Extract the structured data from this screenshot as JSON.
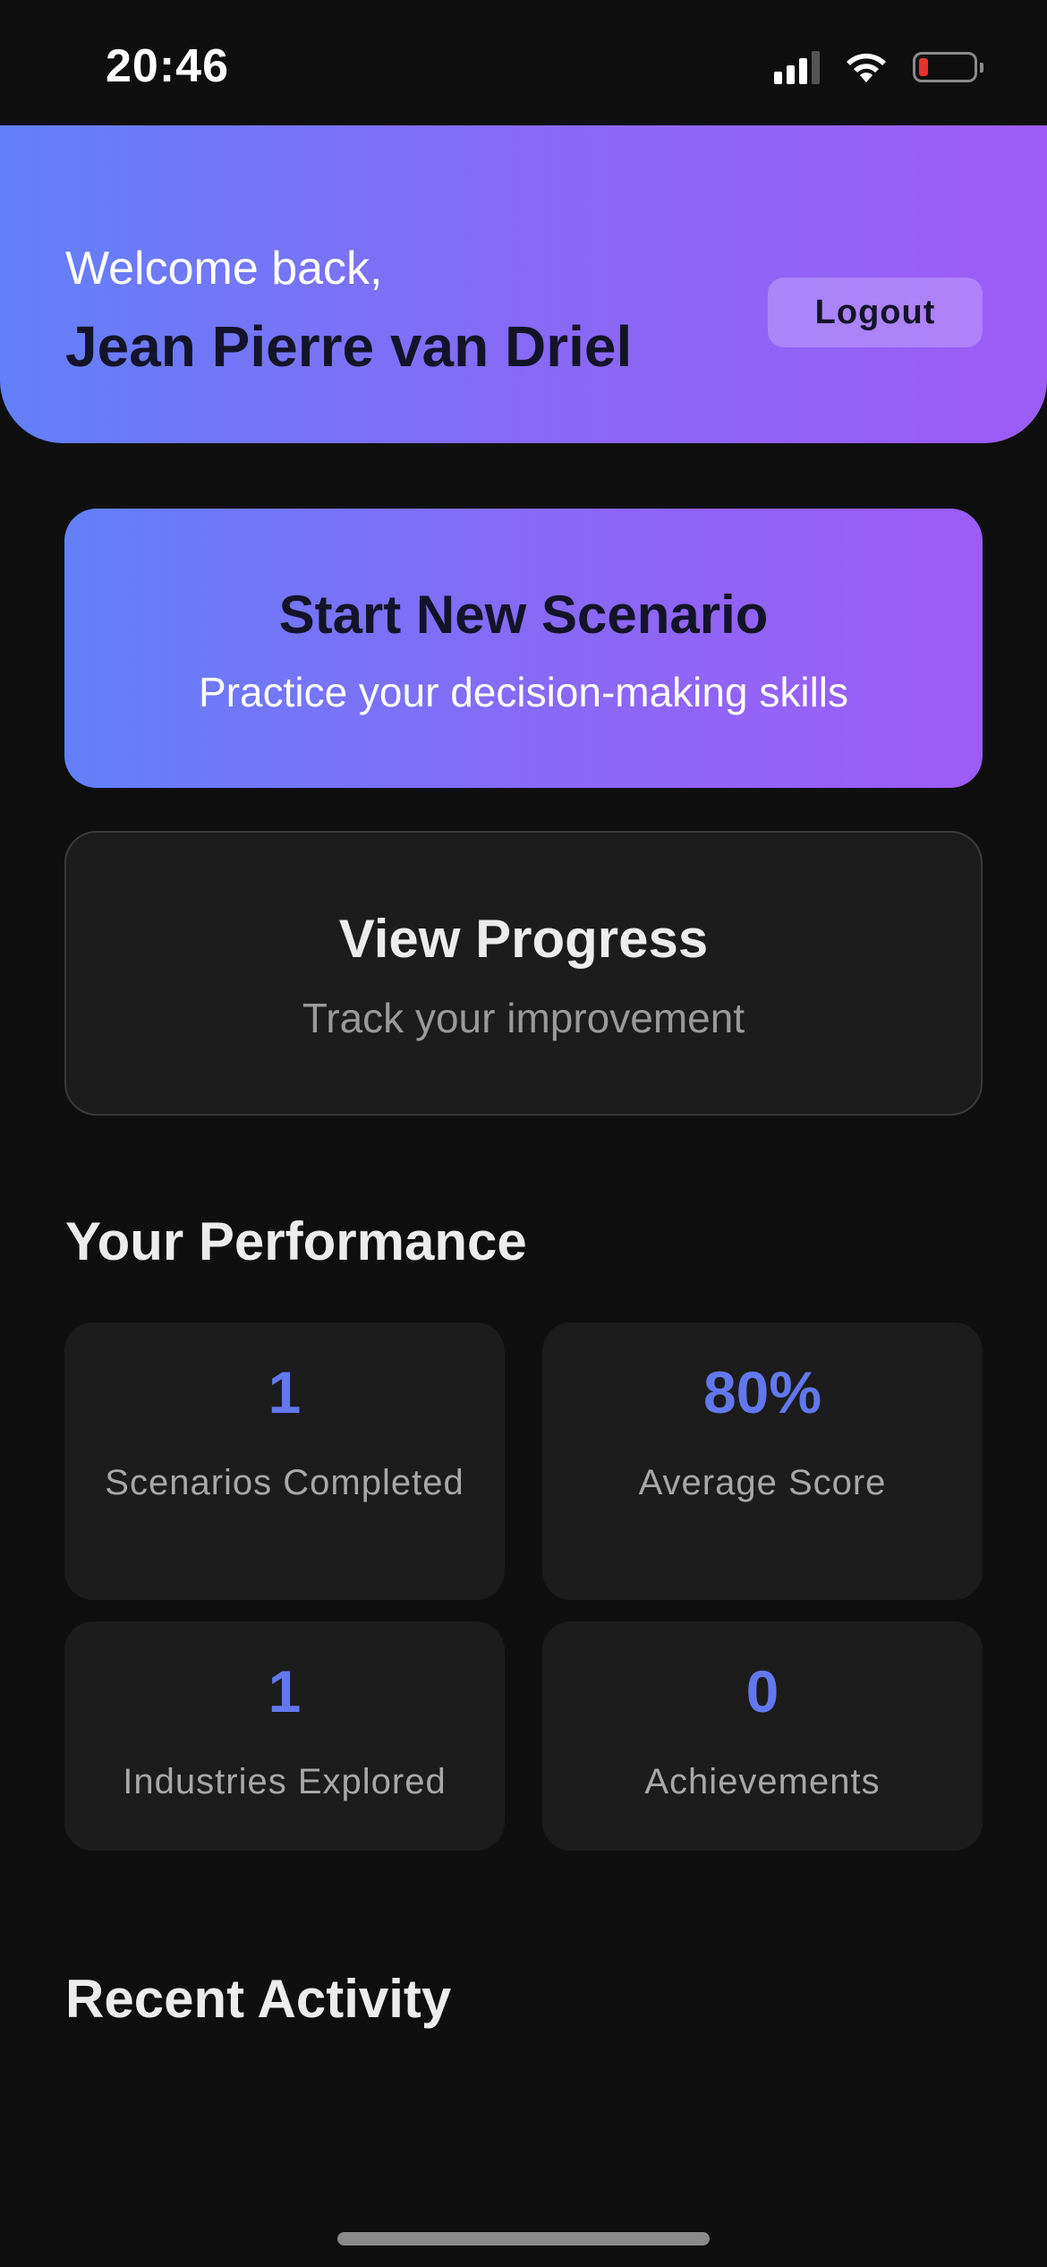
{
  "status_bar": {
    "time": "20:46",
    "icons": [
      "signal-icon",
      "wifi-icon",
      "battery-icon"
    ],
    "battery_color": "#e5322d"
  },
  "header": {
    "welcome": "Welcome back,",
    "user_name": "Jean Pierre van Driel",
    "logout_label": "Logout",
    "gradient_colors": [
      "#6380f8",
      "#9d5cf6"
    ]
  },
  "actions": {
    "start": {
      "title": "Start New Scenario",
      "subtitle": "Practice your decision-making skills"
    },
    "progress": {
      "title": "View Progress",
      "subtitle": "Track your improvement"
    }
  },
  "performance": {
    "title": "Your Performance",
    "stats": [
      {
        "value": "1",
        "label": "Scenarios Completed"
      },
      {
        "value": "80%",
        "label": "Average Score"
      },
      {
        "value": "1",
        "label": "Industries Explored"
      },
      {
        "value": "0",
        "label": "Achievements"
      }
    ],
    "value_color": "#6378ee"
  },
  "recent_activity": {
    "title": "Recent Activity"
  }
}
